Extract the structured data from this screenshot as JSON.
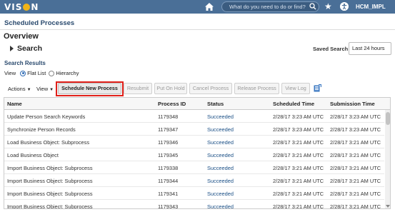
{
  "header": {
    "logo_text_pre": "VIS",
    "logo_text_post": "N",
    "search_placeholder": "What do you need to do or find?",
    "username": "HCM_IMPL",
    "bar_color": "#4a6f97",
    "accent_color": "#f1b417"
  },
  "page": {
    "title": "Scheduled Processes",
    "overview": "Overview",
    "search_label": "Search",
    "saved_search_label": "Saved Search",
    "saved_search_value": "Last 24 hours"
  },
  "results": {
    "title": "Search Results",
    "view_label": "View",
    "flat_list": "Flat List",
    "hierarchy": "Hierarchy",
    "view_selected": "Flat List"
  },
  "toolbar": {
    "actions": "Actions",
    "view": "View",
    "schedule_new": "Schedule New Process",
    "resubmit": "Resubmit",
    "put_on_hold": "Put On Hold",
    "cancel_process": "Cancel Process",
    "release_process": "Release Process",
    "view_log": "View Log"
  },
  "table": {
    "columns": [
      "Name",
      "Process ID",
      "Status",
      "Scheduled Time",
      "Submission Time"
    ],
    "rows": [
      {
        "name": "Update Person Search Keywords",
        "id": "1179348",
        "status": "Succeeded",
        "scheduled": "2/28/17 3:23 AM UTC",
        "submitted": "2/28/17 3:23 AM UTC"
      },
      {
        "name": "Synchronize Person Records",
        "id": "1179347",
        "status": "Succeeded",
        "scheduled": "2/28/17 3:23 AM UTC",
        "submitted": "2/28/17 3:23 AM UTC"
      },
      {
        "name": "Load Business Object: Subprocess",
        "id": "1179346",
        "status": "Succeeded",
        "scheduled": "2/28/17 3:21 AM UTC",
        "submitted": "2/28/17 3:21 AM UTC"
      },
      {
        "name": "Load Business Object",
        "id": "1179345",
        "status": "Succeeded",
        "scheduled": "2/28/17 3:21 AM UTC",
        "submitted": "2/28/17 3:21 AM UTC"
      },
      {
        "name": "Import Business Object: Subprocess",
        "id": "1179338",
        "status": "Succeeded",
        "scheduled": "2/28/17 3:21 AM UTC",
        "submitted": "2/28/17 3:21 AM UTC"
      },
      {
        "name": "Import Business Object: Subprocess",
        "id": "1179344",
        "status": "Succeeded",
        "scheduled": "2/28/17 3:21 AM UTC",
        "submitted": "2/28/17 3:21 AM UTC"
      },
      {
        "name": "Import Business Object: Subprocess",
        "id": "1179341",
        "status": "Succeeded",
        "scheduled": "2/28/17 3:21 AM UTC",
        "submitted": "2/28/17 3:21 AM UTC"
      },
      {
        "name": "Import Business Object: Subprocess",
        "id": "1179343",
        "status": "Succeeded",
        "scheduled": "2/28/17 3:21 AM UTC",
        "submitted": "2/28/17 3:21 AM UTC"
      }
    ]
  }
}
